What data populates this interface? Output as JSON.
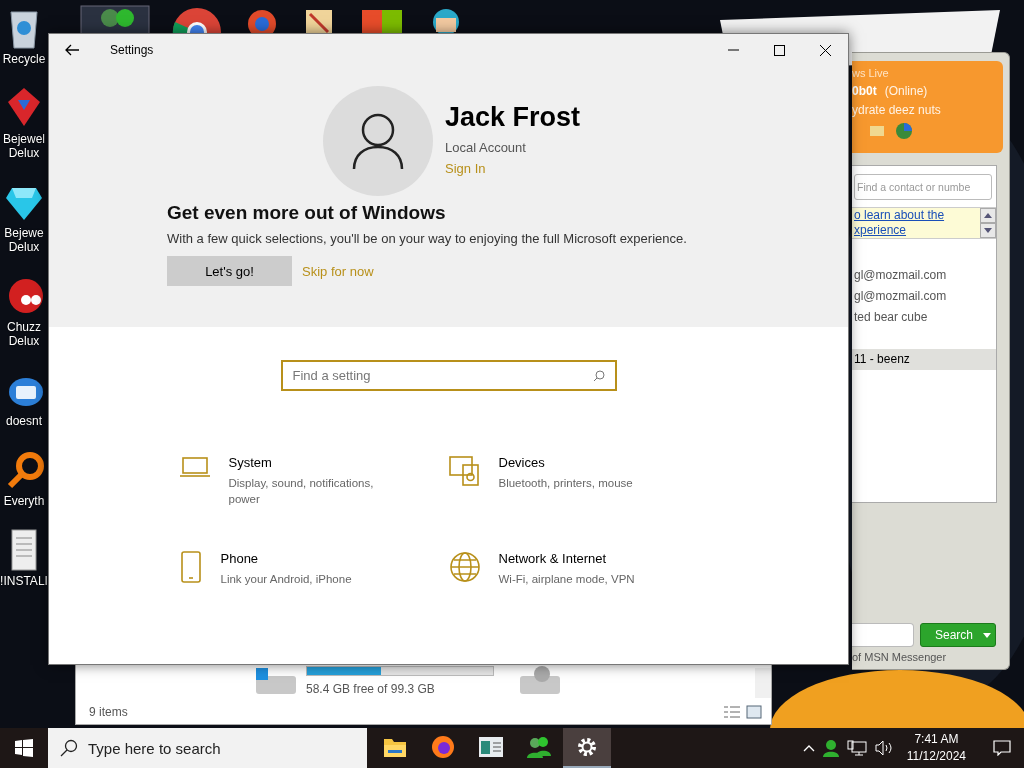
{
  "desktop": {
    "top_icons": [
      {
        "kind": "people"
      },
      {
        "kind": "browser"
      },
      {
        "kind": "swirl"
      },
      {
        "kind": "paint"
      },
      {
        "kind": "tiles"
      },
      {
        "kind": "character"
      }
    ],
    "icons": [
      {
        "kind": "bin",
        "label": "Recycle"
      },
      {
        "kind": "gem2",
        "label": "Bejewel Delux"
      },
      {
        "kind": "gem",
        "label": "Bejewe Delux"
      },
      {
        "kind": "blob",
        "label": "Chuzz Delux"
      },
      {
        "kind": "bird",
        "label": "doesnt"
      },
      {
        "kind": "ring",
        "label": "Everyth"
      },
      {
        "kind": "doc",
        "label": "!INSTALI"
      }
    ]
  },
  "explorer": {
    "free_space": "58.4 GB free of 99.3 GB",
    "level": 0.4,
    "status": "9 items"
  },
  "messenger": {
    "title": "ws Live",
    "user": "0b0t",
    "status": "(Online)",
    "message": "ydrate deez nuts",
    "search": {
      "placeholder": "Find a contact or numbe"
    },
    "banner": [
      "o learn about the",
      "xperience"
    ],
    "contacts": [
      {
        "name": "gl@mozmail.com",
        "selected": false
      },
      {
        "name": "gl@mozmail.com",
        "selected": false
      },
      {
        "name": "ted bear cube",
        "selected": false
      },
      {
        "name": "11 - beenz",
        "selected": true
      }
    ],
    "search_button": "Search",
    "footer": "of MSN Messenger"
  },
  "settings": {
    "title": "Settings",
    "profile": {
      "name": "Jack Frost",
      "account": "Local Account",
      "action": "Sign In"
    },
    "promo": {
      "heading": "Get even more out of Windows",
      "text": "With a few quick selections, you'll be on your way to enjoying the full Microsoft experience.",
      "primary": "Let's go!",
      "secondary": "Skip for now"
    },
    "search": {
      "placeholder": "Find a setting"
    },
    "categories": [
      {
        "kind": "laptop",
        "title": "System",
        "description": "Display, sound, notifications, power"
      },
      {
        "kind": "devices",
        "title": "Devices",
        "description": "Bluetooth, printers, mouse"
      },
      {
        "kind": "phone",
        "title": "Phone",
        "description": "Link your Android, iPhone"
      },
      {
        "kind": "globe",
        "title": "Network & Internet",
        "description": "Wi-Fi, airplane mode, VPN"
      }
    ]
  },
  "taskbar": {
    "search": {
      "placeholder": "Type here to search"
    },
    "apps": [
      {
        "kind": "folder",
        "selected": false
      },
      {
        "kind": "firefox",
        "selected": false
      },
      {
        "kind": "window",
        "selected": false
      },
      {
        "kind": "people",
        "selected": false
      },
      {
        "kind": "gear",
        "selected": true
      }
    ],
    "time": "7:41 AM",
    "date": "11/12/2024"
  }
}
